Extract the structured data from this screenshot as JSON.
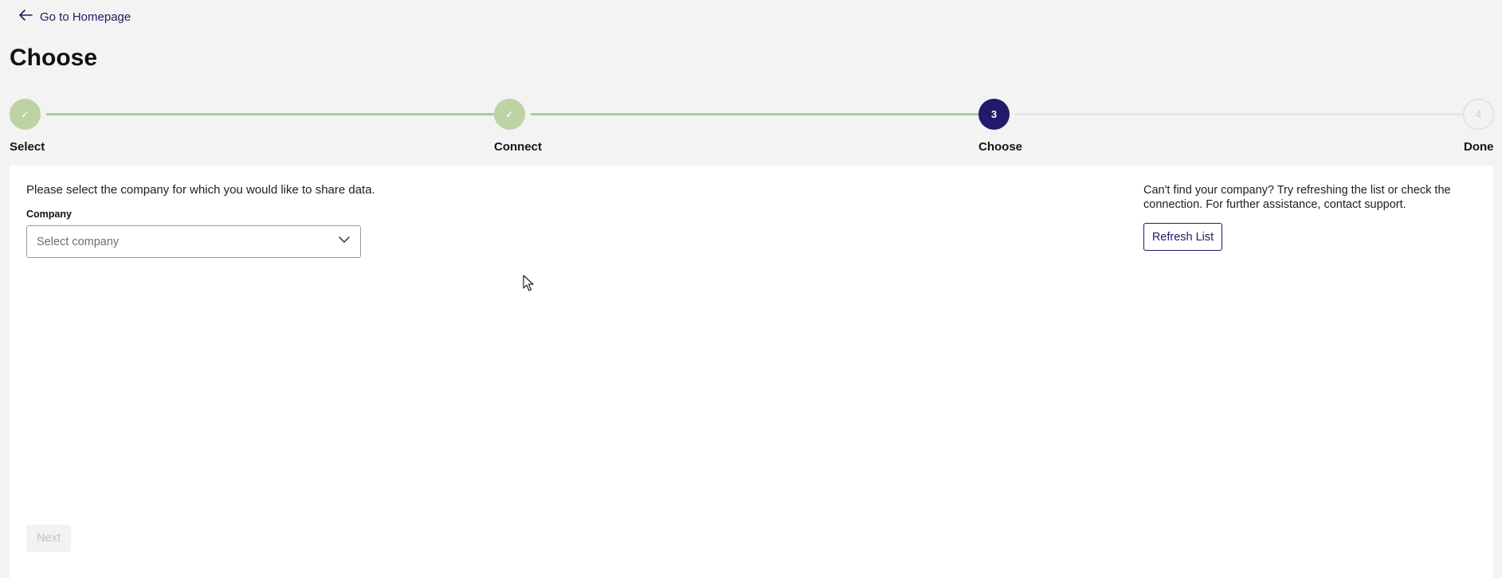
{
  "header": {
    "back_label": "Go to Homepage",
    "page_title": "Choose"
  },
  "stepper": {
    "steps": [
      {
        "label": "Select",
        "status": "complete",
        "number": "1"
      },
      {
        "label": "Connect",
        "status": "complete",
        "number": "2"
      },
      {
        "label": "Choose",
        "status": "active",
        "number": "3"
      },
      {
        "label": "Done",
        "status": "pending",
        "number": "4"
      }
    ],
    "check_glyph": "✓"
  },
  "main": {
    "instruction": "Please select the company for which you would like to share data.",
    "company_label": "Company",
    "company_placeholder": "Select company",
    "help_text": "Can't find your company? Try refreshing the list or check the connection. For further assistance, contact support.",
    "refresh_label": "Refresh List",
    "next_label": "Next"
  },
  "colors": {
    "brand": "#221a6b",
    "complete": "#bdd3a4",
    "complete_line": "#a6cf98"
  }
}
